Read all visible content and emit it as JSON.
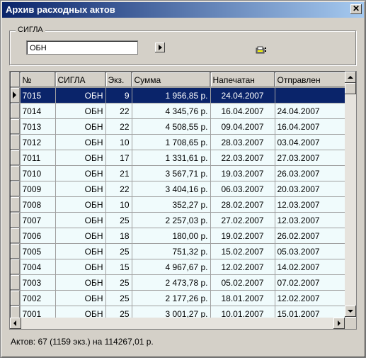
{
  "window": {
    "title": "Архив расходных актов"
  },
  "filter": {
    "group_label": "СИГЛА",
    "sigla_value": "ОБН"
  },
  "table": {
    "columns": [
      "№",
      "СИГЛА",
      "Экз.",
      "Сумма",
      "Напечатан",
      "Отправлен"
    ],
    "rows": [
      [
        "7015",
        "ОБН",
        "9",
        "1 956,85 р.",
        "24.04.2007",
        ""
      ],
      [
        "7014",
        "ОБН",
        "22",
        "4 345,76 р.",
        "16.04.2007",
        "24.04.2007"
      ],
      [
        "7013",
        "ОБН",
        "22",
        "4 508,55 р.",
        "09.04.2007",
        "16.04.2007"
      ],
      [
        "7012",
        "ОБН",
        "10",
        "1 708,65 р.",
        "28.03.2007",
        "03.04.2007"
      ],
      [
        "7011",
        "ОБН",
        "17",
        "1 331,61 р.",
        "22.03.2007",
        "27.03.2007"
      ],
      [
        "7010",
        "ОБН",
        "21",
        "3 567,71 р.",
        "19.03.2007",
        "26.03.2007"
      ],
      [
        "7009",
        "ОБН",
        "22",
        "3 404,16 р.",
        "06.03.2007",
        "20.03.2007"
      ],
      [
        "7008",
        "ОБН",
        "10",
        "352,27 р.",
        "28.02.2007",
        "12.03.2007"
      ],
      [
        "7007",
        "ОБН",
        "25",
        "2 257,03 р.",
        "27.02.2007",
        "12.03.2007"
      ],
      [
        "7006",
        "ОБН",
        "18",
        "180,00 р.",
        "19.02.2007",
        "26.02.2007"
      ],
      [
        "7005",
        "ОБН",
        "25",
        "751,32 р.",
        "15.02.2007",
        "05.03.2007"
      ],
      [
        "7004",
        "ОБН",
        "15",
        "4 967,67 р.",
        "12.02.2007",
        "14.02.2007"
      ],
      [
        "7003",
        "ОБН",
        "25",
        "2 473,78 р.",
        "05.02.2007",
        "07.02.2007"
      ],
      [
        "7002",
        "ОБН",
        "25",
        "2 177,26 р.",
        "18.01.2007",
        "12.02.2007"
      ],
      [
        "7001",
        "ОБН",
        "25",
        "3 001,27 р.",
        "10.01.2007",
        "15.01.2007"
      ]
    ]
  },
  "status": {
    "summary": "Актов: 67 (1159 экз.) на 114267,01 р."
  },
  "colors": {
    "selection": "#0a246a",
    "row_bg": "#f0fbfc",
    "face": "#d4d0c8"
  }
}
